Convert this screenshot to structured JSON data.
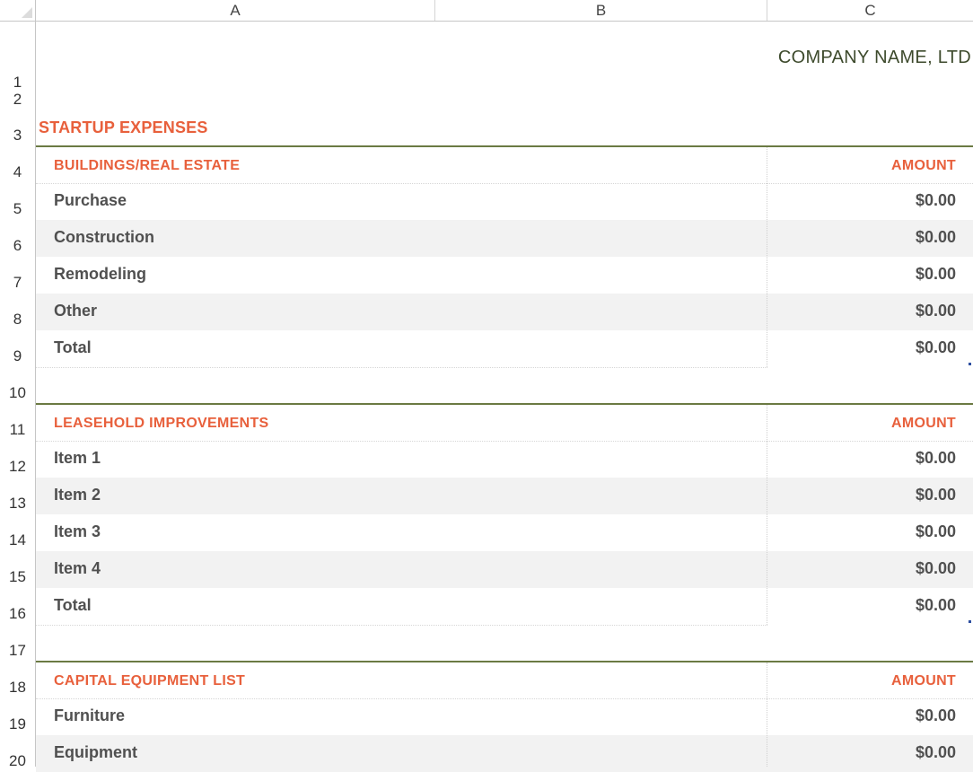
{
  "columns": [
    "A",
    "B",
    "C"
  ],
  "rows": [
    "1",
    "2",
    "3",
    "4",
    "5",
    "6",
    "7",
    "8",
    "9",
    "10",
    "11",
    "12",
    "13",
    "14",
    "15",
    "16",
    "17",
    "18",
    "19",
    "20"
  ],
  "company_name": "COMPANY NAME, LTD",
  "title": "STARTUP EXPENSES",
  "colors": {
    "accent": "#e8603c",
    "rule": "#6b7a43",
    "text": "#505050",
    "shade": "#f2f2f2"
  },
  "sections": [
    {
      "header": "BUILDINGS/REAL ESTATE",
      "amount_header": "AMOUNT",
      "items": [
        {
          "label": "Purchase",
          "amount": "$0.00"
        },
        {
          "label": "Construction",
          "amount": "$0.00"
        },
        {
          "label": "Remodeling",
          "amount": "$0.00"
        },
        {
          "label": "Other",
          "amount": "$0.00"
        },
        {
          "label": "Total",
          "amount": "$0.00"
        }
      ]
    },
    {
      "header": "LEASEHOLD IMPROVEMENTS",
      "amount_header": "AMOUNT",
      "items": [
        {
          "label": "Item 1",
          "amount": "$0.00"
        },
        {
          "label": "Item 2",
          "amount": "$0.00"
        },
        {
          "label": "Item 3",
          "amount": "$0.00"
        },
        {
          "label": "Item 4",
          "amount": "$0.00"
        },
        {
          "label": "Total",
          "amount": "$0.00"
        }
      ]
    },
    {
      "header": "CAPITAL EQUIPMENT LIST",
      "amount_header": "AMOUNT",
      "items": [
        {
          "label": "Furniture",
          "amount": "$0.00"
        },
        {
          "label": "Equipment",
          "amount": "$0.00"
        }
      ]
    }
  ]
}
